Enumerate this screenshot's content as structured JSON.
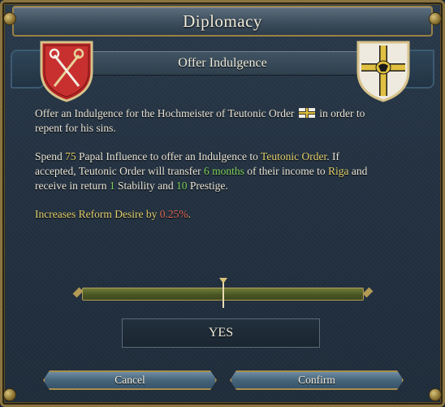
{
  "window": {
    "title": "Diplomacy"
  },
  "dialog": {
    "subtitle": "Offer Indulgence"
  },
  "text": {
    "p1_pre": "Offer an Indulgence for the Hochmeister of Teutonic Order",
    "p1_post": "in order to repent for his sins.",
    "p2_a": "Spend ",
    "p2_cost": "75",
    "p2_b": " Papal Influence to offer an Indulgence to ",
    "p2_target": "Teutonic Order",
    "p2_c": ". If accepted, Teutonic Order will transfer ",
    "p2_months": "6 months",
    "p2_d": " of their income to ",
    "p2_recipient": "Riga",
    "p2_e": " and receive in return ",
    "p2_stability": "1",
    "p2_f": " Stability and ",
    "p2_prestige": "10",
    "p2_g": " Prestige.",
    "p3_pre": "Increases Reform Desire by ",
    "p3_value": "0.25%",
    "p3_post": "."
  },
  "acceptance": {
    "marker_fraction": 0.5,
    "result": "YES"
  },
  "buttons": {
    "cancel": "Cancel",
    "confirm": "Confirm"
  },
  "icons": {
    "left_shield": "papal-crossed-keys-shield-icon",
    "right_shield": "teutonic-order-shield-icon",
    "inline_flag": "teutonic-order-flag-icon"
  },
  "colors": {
    "highlight_gold": "#e3cf6a",
    "highlight_green": "#7ed05a",
    "highlight_red": "#e06a55"
  }
}
